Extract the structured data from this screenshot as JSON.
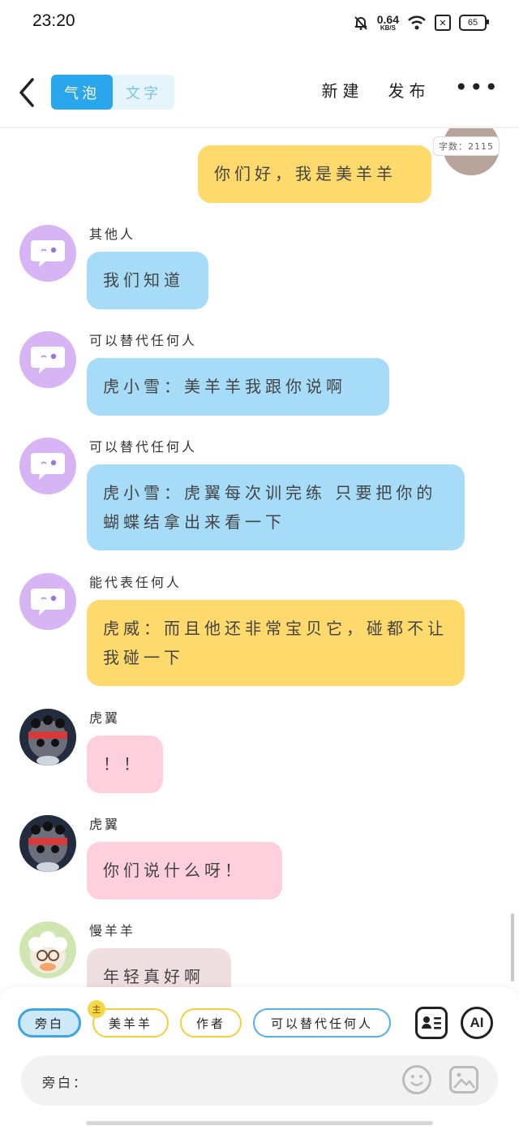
{
  "status": {
    "time": "23:20",
    "speed_value": "0.64",
    "speed_unit": "KB/S",
    "battery": "65"
  },
  "header": {
    "tabs": [
      {
        "label": "气泡",
        "active": true
      },
      {
        "label": "文字",
        "active": false
      }
    ],
    "new_label": "新建",
    "publish_label": "发布",
    "more_label": "•••"
  },
  "word_count": "字数：2115",
  "messages": [
    {
      "speaker": "",
      "text": "你们好，我是美羊羊",
      "color": "#fed96b",
      "side": "right"
    },
    {
      "speaker": "其他人",
      "text": "我们知道",
      "color": "#a6dcf8",
      "avatar": "bot-icon"
    },
    {
      "speaker": "可以替代任何人",
      "text": "虎小雪：美羊羊我跟你说啊",
      "color": "#a6dcf8",
      "avatar": "bot-icon"
    },
    {
      "speaker": "可以替代任何人",
      "text": "虎小雪：虎翼每次训完练 只要把你的蝴蝶结拿出来看一下",
      "color": "#a6dcf8",
      "avatar": "bot-icon"
    },
    {
      "speaker": "能代表任何人",
      "text": "虎威：而且他还非常宝贝它，碰都不让我碰一下",
      "color": "#fed96b",
      "avatar": "bot-icon"
    },
    {
      "speaker": "虎翼",
      "text": "！！",
      "color": "#fecfdc",
      "avatar": "character-avatar"
    },
    {
      "speaker": "虎翼",
      "text": "你们说什么呀！",
      "color": "#fecfdc",
      "avatar": "character-avatar"
    },
    {
      "speaker": "慢羊羊",
      "text": "年轻真好啊",
      "color": "#f0dfe0",
      "avatar": "character-avatar"
    }
  ],
  "bottom": {
    "chips": [
      {
        "label": "旁白",
        "selected": true
      },
      {
        "label": "美羊羊",
        "badge": "主"
      },
      {
        "label": "作者"
      },
      {
        "label": "可以替代任何人"
      }
    ],
    "ai_label": "AI",
    "input_label": "旁白："
  }
}
